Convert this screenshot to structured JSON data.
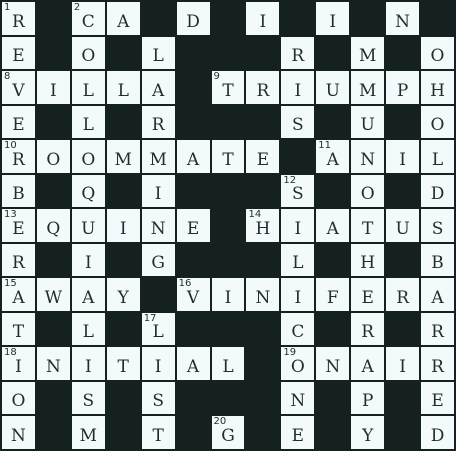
{
  "puzzle": {
    "rows": 13,
    "cols": 13,
    "colors": {
      "cell": "#f2fafb",
      "block": "#142120",
      "text": "#1f2d2d"
    },
    "grid": [
      "R#CA#D#I#I#N",
      "E#O#L###R#M#O",
      "VILLA#TRIUMPH",
      "E#L#R###S#U#O",
      "ROOMMATE#ANIL",
      "B#Q#I###S#O#D",
      "EQUINE#HIATUS",
      "R#I#G###L#H#B",
      "AWAY#VINIFERA",
      "T#L#L###C#R#R",
      "INITIAL#ONAIR",
      "O#S#S###N#P#E",
      "N#M#T#G#E#Y#D"
    ],
    "numbers": [
      {
        "r": 0,
        "c": 0,
        "n": "1"
      },
      {
        "r": 0,
        "c": 2,
        "n": "2"
      },
      {
        "r": 0,
        "c": 4,
        "n": "3"
      },
      {
        "r": 0,
        "c": 6,
        "n": "4"
      },
      {
        "r": 0,
        "c": 8,
        "n": "5"
      },
      {
        "r": 0,
        "c": 10,
        "n": "6"
      },
      {
        "r": 0,
        "c": 12,
        "n": "7"
      },
      {
        "r": 2,
        "c": 0,
        "n": "8"
      },
      {
        "r": 2,
        "c": 6,
        "n": "9"
      },
      {
        "r": 4,
        "c": 0,
        "n": "10"
      },
      {
        "r": 4,
        "c": 9,
        "n": "11"
      },
      {
        "r": 5,
        "c": 8,
        "n": "12"
      },
      {
        "r": 6,
        "c": 0,
        "n": "13"
      },
      {
        "r": 6,
        "c": 7,
        "n": "14"
      },
      {
        "r": 8,
        "c": 0,
        "n": "15"
      },
      {
        "r": 8,
        "c": 5,
        "n": "16"
      },
      {
        "r": 9,
        "c": 4,
        "n": "17"
      },
      {
        "r": 10,
        "c": 0,
        "n": "18"
      },
      {
        "r": 10,
        "c": 8,
        "n": "19"
      },
      {
        "r": 12,
        "c": 6,
        "n": "20"
      }
    ]
  }
}
